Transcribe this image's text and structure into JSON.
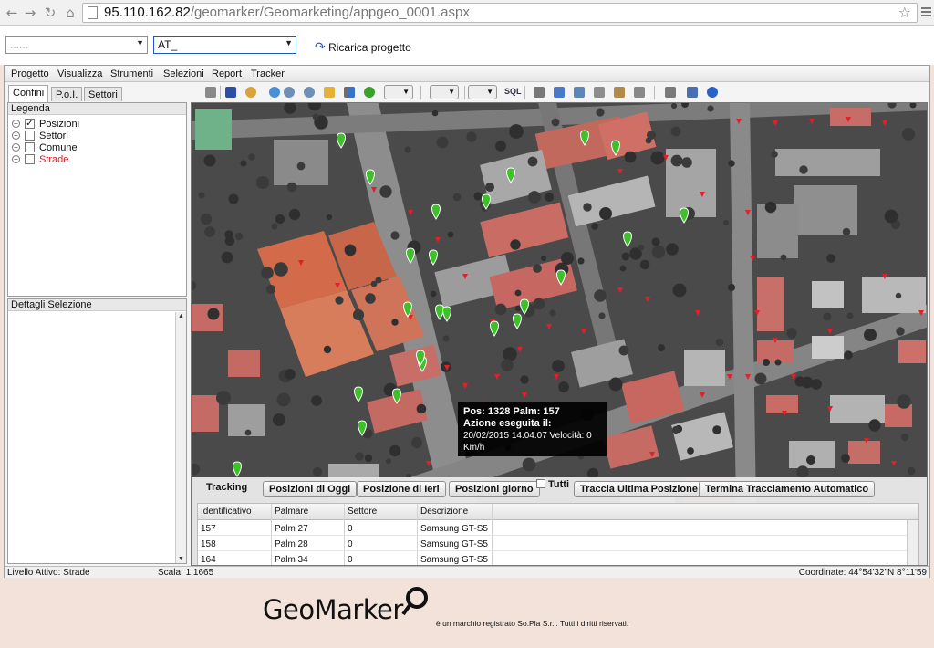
{
  "browser": {
    "url_host": "95.110.162.82",
    "url_path": "/geomarker/Geomarketing/appgeo_0001.aspx"
  },
  "project": {
    "select1_value": "......",
    "select2_value": "AT_",
    "reload_label": "Ricarica progetto"
  },
  "menu": [
    "Progetto",
    "Visualizza",
    "Strumenti",
    "Selezioni",
    "Report",
    "Tracker"
  ],
  "tabs": [
    "Confini",
    "P.o.I.",
    "Settori"
  ],
  "legend": {
    "title": "Legenda",
    "layers": [
      {
        "label": "Posizioni",
        "checked": true,
        "color": "#111111"
      },
      {
        "label": "Settori",
        "checked": false,
        "color": "#111111"
      },
      {
        "label": "Comune",
        "checked": false,
        "color": "#111111"
      },
      {
        "label": "Strade",
        "checked": false,
        "color": "#cc2222"
      }
    ]
  },
  "details": {
    "title": "Dettagli Selezione"
  },
  "toolbar": {
    "sql_label": "SQL"
  },
  "tooltip": {
    "line1": "Pos: 1328 Palm: 157",
    "line2": "Azione eseguita il:",
    "line3": "20/02/2015 14.04.07 Velocità: 0",
    "line4": "Km/h"
  },
  "tracking": {
    "label": "Tracking",
    "btn_oggi": "Posizioni di Oggi",
    "btn_ieri": "Posizione di Ieri",
    "btn_giorno": "Posizioni giorno",
    "tutti": "Tutti",
    "btn_traccia": "Traccia Ultima Posizione",
    "btn_termina": "Termina Tracciamento Automatico"
  },
  "grid": {
    "columns": [
      "Identificativo",
      "Palmare",
      "Settore",
      "Descrizione"
    ],
    "rows": [
      [
        "157",
        "Palm 27",
        "0",
        "Samsung GT-S5"
      ],
      [
        "158",
        "Palm 28",
        "0",
        "Samsung GT-S5"
      ],
      [
        "164",
        "Palm 34",
        "0",
        "Samsung GT-S5"
      ]
    ]
  },
  "status": {
    "livello": "Livello Attivo: Strade",
    "scala": "Scala: 1:1665",
    "coordinate": "Coordinate: 44°54'32\"N 8°11'59"
  },
  "footer": {
    "logo": "GeoMarker",
    "rights": "è un marchio registrato So.Pla S.r.l. Tutti i diritti riservati."
  },
  "colors": {
    "pin_green": "#3fbf2a",
    "marker_red": "#e3202a",
    "selection_blue": "#2155c3"
  }
}
